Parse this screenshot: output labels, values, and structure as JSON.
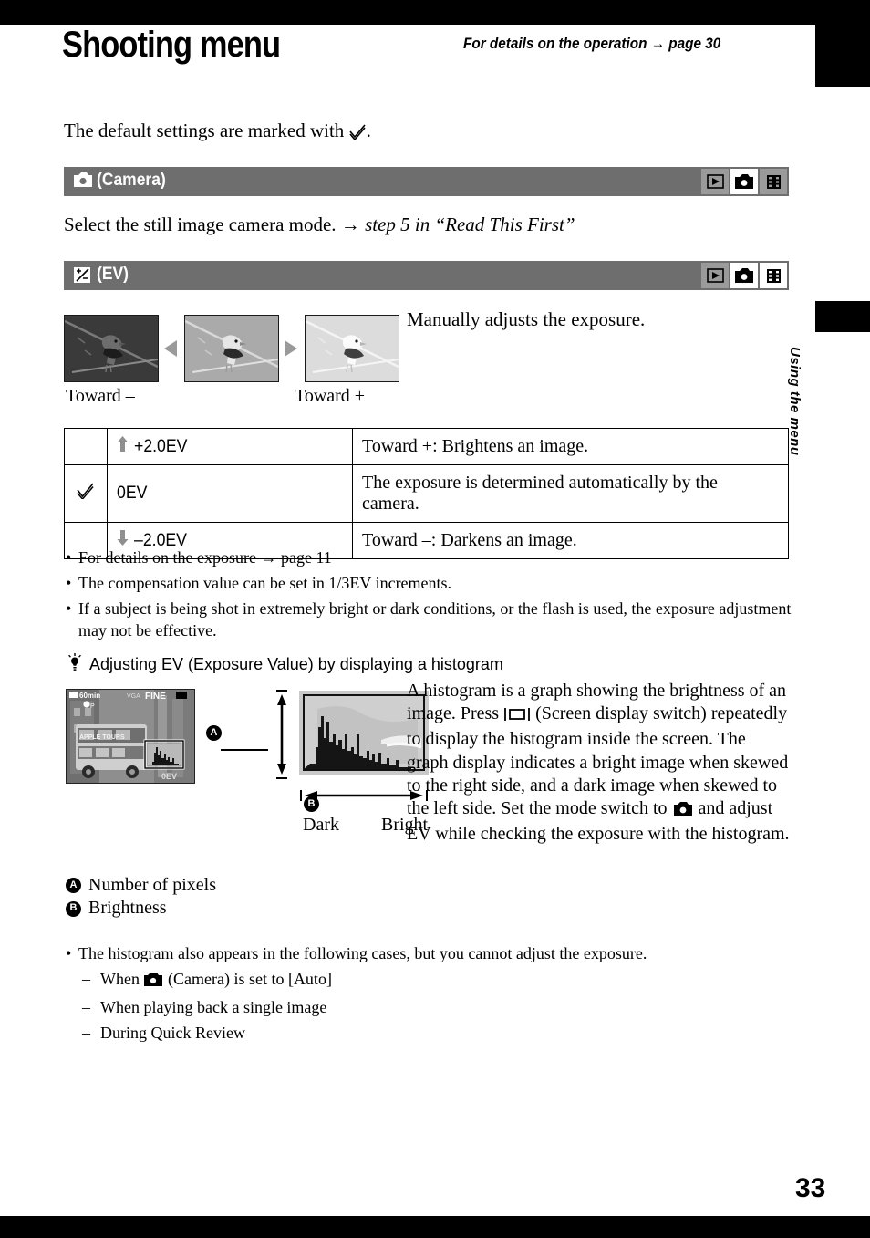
{
  "header": {
    "title": "Shooting menu",
    "note": "For details on the operation → page 30"
  },
  "intro": "The default settings are marked with",
  "sections": [
    {
      "id": "camera",
      "icon": "camera-icon",
      "label": "(Camera)",
      "modes": [
        {
          "name": "playback-icon",
          "active": false
        },
        {
          "name": "camera-icon",
          "active": true
        },
        {
          "name": "movie-icon",
          "active": false
        }
      ],
      "body": "Select the still image camera mode. → ",
      "body_italic": "step 5 in “Read This First”"
    },
    {
      "id": "ev",
      "icon": "ev-icon",
      "label": "(EV)",
      "modes": [
        {
          "name": "playback-icon",
          "active": false
        },
        {
          "name": "camera-icon",
          "active": true
        },
        {
          "name": "movie-icon",
          "active": true
        }
      ]
    }
  ],
  "ev_figure": {
    "caption_left": "Toward –",
    "caption_right": "Toward +",
    "description": "Manually adjusts the exposure."
  },
  "ev_table": {
    "rows": [
      {
        "check": false,
        "arrow": "up",
        "value": "+2.0EV",
        "desc": "Toward +: Brightens an image."
      },
      {
        "check": true,
        "arrow": "none",
        "value": "0EV",
        "desc": "The exposure is determined automatically by the camera."
      },
      {
        "check": false,
        "arrow": "down",
        "value": "–2.0EV",
        "desc": "Toward –: Darkens an image."
      }
    ]
  },
  "notes": [
    "For details on the exposure → page 11",
    "The compensation value can be set in 1/3EV increments.",
    "If a subject is being shot in extremely bright or dark conditions, or the flash is used, the exposure adjustment may not be effective."
  ],
  "tip": {
    "icon": "lightbulb-icon",
    "heading": "Adjusting EV (Exposure Value) by displaying a histogram",
    "paragraph_1": "A histogram is a graph showing the brightness of an image. Press ",
    "paragraph_2": " (Screen display switch) repeatedly to display the histogram inside the screen. The graph display indicates a bright image when skewed to the right side, and a dark image when skewed to the left side. Set the mode switch to ",
    "paragraph_3": " and adjust EV while checking the exposure with the histogram.",
    "axis_dark": "Dark",
    "axis_bright": "Bright",
    "badge_a": "A",
    "badge_b": "B",
    "lcd_overlay": {
      "rec_time": "60min",
      "quality": "FINE",
      "ev": "0EV",
      "bus_text": "APPLE TOURS"
    }
  },
  "legend": [
    {
      "badge": "A",
      "text": "Number of pixels"
    },
    {
      "badge": "B",
      "text": "Brightness"
    }
  ],
  "notes2": {
    "lead": "The histogram also appears in the following cases, but you cannot adjust the exposure.",
    "sub": [
      {
        "pre": "When ",
        "icon": "camera-icon",
        "post": " (Camera) is set to [Auto]"
      },
      {
        "pre": "When playing back a single image",
        "icon": null,
        "post": ""
      },
      {
        "pre": "During Quick Review",
        "icon": null,
        "post": ""
      }
    ]
  },
  "side_tab": {
    "label": "Using the menu"
  },
  "page_number": "33",
  "colors": {
    "section_bar": "#6e6e6e",
    "mode_inactive": "#9a9a9a",
    "mode_active": "#ffffff",
    "arrow_gray": "#9a9a9a",
    "black": "#000000"
  }
}
